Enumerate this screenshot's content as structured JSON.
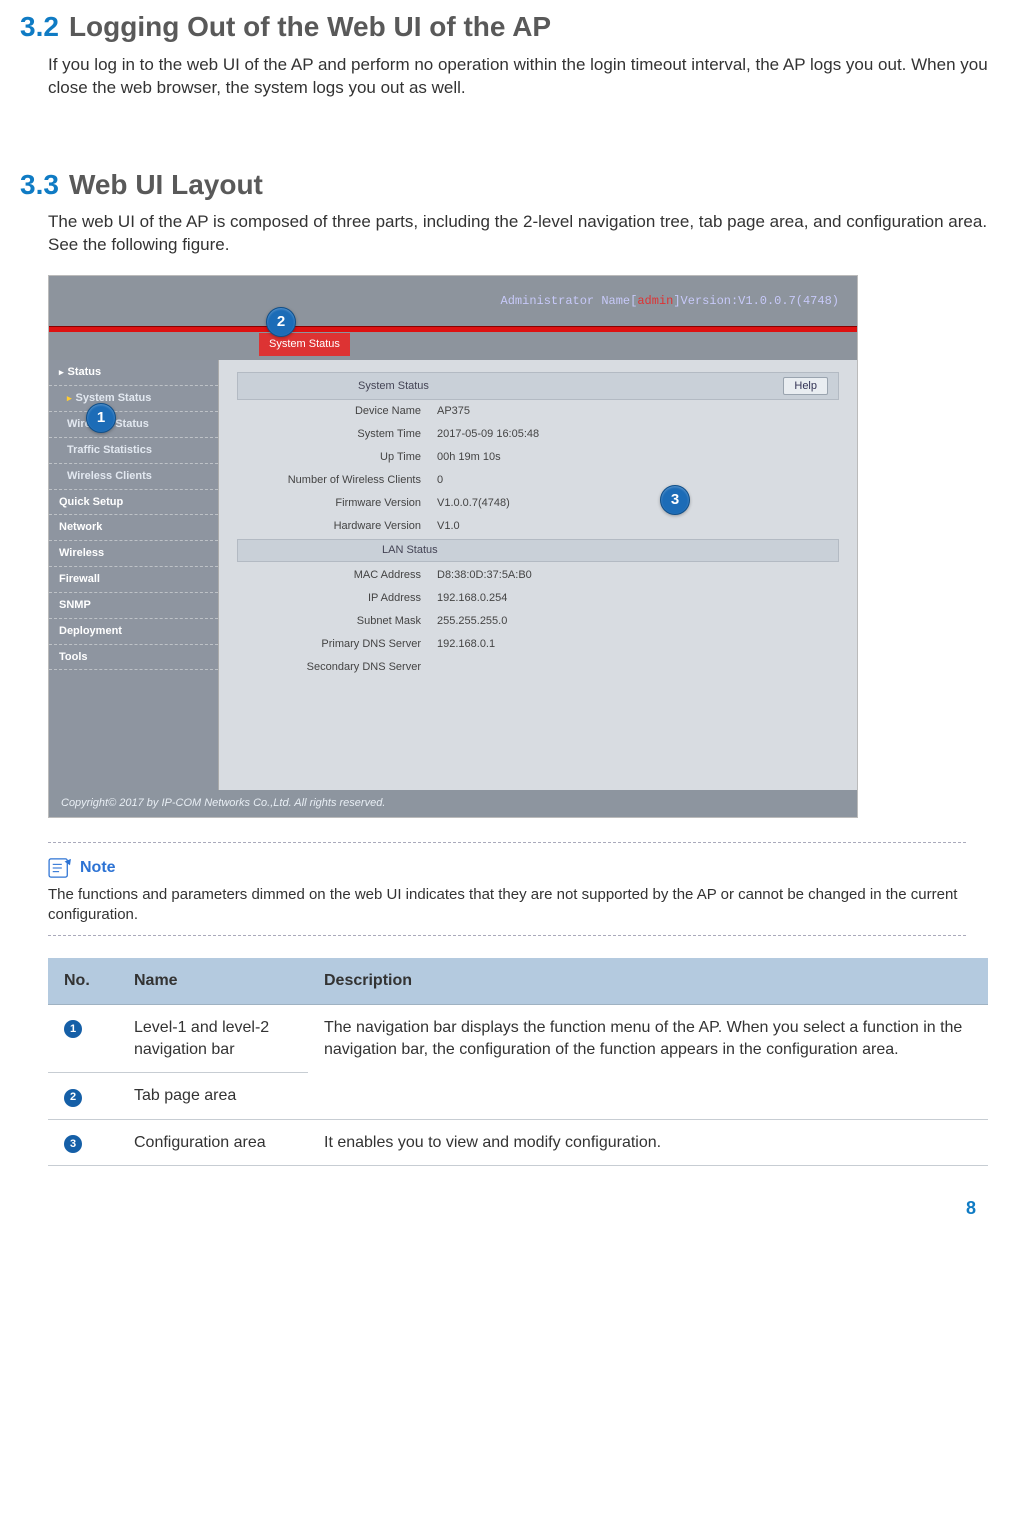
{
  "section32": {
    "number": "3.2",
    "title": "Logging Out of the Web UI of the AP",
    "body": "If you log in to the web UI of the AP and perform no operation within the login timeout interval, the AP logs you out. When you close the web browser, the system logs you out as well."
  },
  "section33": {
    "number": "3.3",
    "title": "Web UI Layout",
    "body": "The web UI of the AP is composed of three parts, including the 2-level navigation tree, tab page area, and configuration area. See the following figure."
  },
  "screenshot": {
    "admin_label": "Administrator Name[",
    "admin_user": "admin",
    "version_label": "]Version:V1.0.0.7(4748)",
    "tab": "System Status",
    "nav_l1_active": "Status",
    "nav_sub": [
      "System Status",
      "Wireless Status",
      "Traffic Statistics",
      "Wireless Clients"
    ],
    "nav_l1_rest": [
      "Quick Setup",
      "Network",
      "Wireless",
      "Firewall",
      "SNMP",
      "Deployment",
      "Tools"
    ],
    "panel_head": "System Status",
    "help": "Help",
    "fields": [
      {
        "label": "Device Name",
        "value": "AP375"
      },
      {
        "label": "System Time",
        "value": "2017-05-09 16:05:48"
      },
      {
        "label": "Up Time",
        "value": "00h 19m 10s"
      },
      {
        "label": "Number of Wireless Clients",
        "value": "0"
      },
      {
        "label": "Firmware Version",
        "value": "V1.0.0.7(4748)"
      },
      {
        "label": "Hardware Version",
        "value": "V1.0"
      }
    ],
    "lan_head": "LAN Status",
    "lan_fields": [
      {
        "label": "MAC Address",
        "value": "D8:38:0D:37:5A:B0"
      },
      {
        "label": "IP Address",
        "value": "192.168.0.254"
      },
      {
        "label": "Subnet Mask",
        "value": "255.255.255.0"
      },
      {
        "label": "Primary DNS Server",
        "value": "192.168.0.1"
      },
      {
        "label": "Secondary DNS Server",
        "value": ""
      }
    ],
    "copyright": "Copyright© 2017 by IP-COM Networks Co.,Ltd. All rights reserved."
  },
  "callouts": {
    "c1": "1",
    "c2": "2",
    "c3": "3"
  },
  "note": {
    "label": "Note",
    "text": "The functions and parameters dimmed on the web UI indicates that they are not supported by the AP or cannot be changed in the current configuration."
  },
  "table": {
    "headers": {
      "no": "No.",
      "name": "Name",
      "desc": "Description"
    },
    "rows": [
      {
        "num": "1",
        "name": "Level-1 and level-2 navigation bar",
        "desc": "The navigation bar displays the function menu of the AP. When you select a function in the navigation bar, the configuration of the function appears in the configuration area."
      },
      {
        "num": "2",
        "name": "Tab page area",
        "desc": ""
      },
      {
        "num": "3",
        "name": "Configuration area",
        "desc": "It enables you to view and modify configuration."
      }
    ]
  },
  "page_number": "8"
}
